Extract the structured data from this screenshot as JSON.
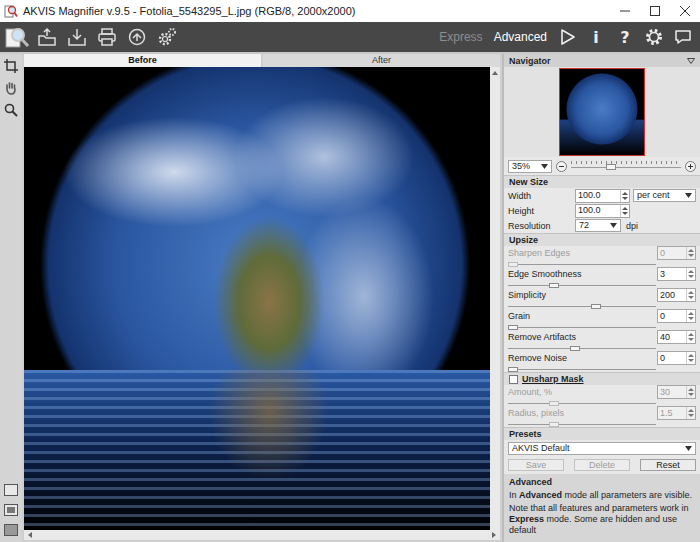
{
  "window": {
    "title": "AKVIS Magnifier v.9.5 - Fotolia_5543295_L.jpg (RGB/8, 2000x2000)"
  },
  "toolbar": {
    "modes": [
      {
        "label": "Express",
        "selected": false
      },
      {
        "label": "Advanced",
        "selected": true
      }
    ],
    "glyphs": [
      "i",
      "?"
    ]
  },
  "tabs": [
    {
      "label": "Before",
      "selected": true
    },
    {
      "label": "After",
      "selected": false
    }
  ],
  "navigator": {
    "title": "Navigator",
    "zoom": "35%",
    "level": 0.35
  },
  "new_size": {
    "title": "New Size",
    "fields": [
      {
        "label": "Width",
        "value": "100.0",
        "kind": "spin",
        "unit": "per cent",
        "unit_kind": "dropdown"
      },
      {
        "label": "Height",
        "value": "100.0",
        "kind": "spin"
      },
      {
        "label": "Resolution",
        "value": "72",
        "kind": "combo",
        "unit": "dpi",
        "unit_kind": "text"
      }
    ]
  },
  "upsize": {
    "title": "Upsize",
    "params": [
      {
        "label": "Sharpen Edges",
        "value": "0",
        "level": 0,
        "disabled": true
      },
      {
        "label": "Edge Smoothness",
        "value": "3",
        "level": 0.3,
        "disabled": false
      },
      {
        "label": "Simplicity",
        "value": "200",
        "level": 0.6,
        "disabled": false
      },
      {
        "label": "Grain",
        "value": "0",
        "level": 0,
        "disabled": false
      },
      {
        "label": "Remove Artifacts",
        "value": "40",
        "level": 0.45,
        "disabled": false
      },
      {
        "label": "Remove Noise",
        "value": "0",
        "level": 0,
        "disabled": false
      }
    ]
  },
  "unsharp_mask": {
    "label": "Unsharp Mask",
    "checked": false,
    "params": [
      {
        "label": "Amount, %",
        "value": "30",
        "level": 0.3,
        "disabled": true
      },
      {
        "label": "Radius, pixels",
        "value": "1.5",
        "level": 0.3,
        "disabled": true
      }
    ]
  },
  "presets": {
    "title": "Presets",
    "value": "AKVIS Default",
    "buttons": [
      {
        "label": "Save",
        "disabled": true
      },
      {
        "label": "Delete",
        "disabled": true
      },
      {
        "label": "Reset",
        "disabled": false
      }
    ]
  },
  "help": {
    "title": "Advanced",
    "paragraphs": [
      [
        {
          "text": "In ",
          "bold": false
        },
        {
          "text": "Advanced",
          "bold": true
        },
        {
          "text": " mode all parameters are visible.",
          "bold": false
        }
      ],
      [
        {
          "text": "Note that all features and parameters work in ",
          "bold": false
        },
        {
          "text": "Express",
          "bold": true
        },
        {
          "text": " mode. Some are hidden and use default",
          "bold": false
        }
      ]
    ]
  }
}
